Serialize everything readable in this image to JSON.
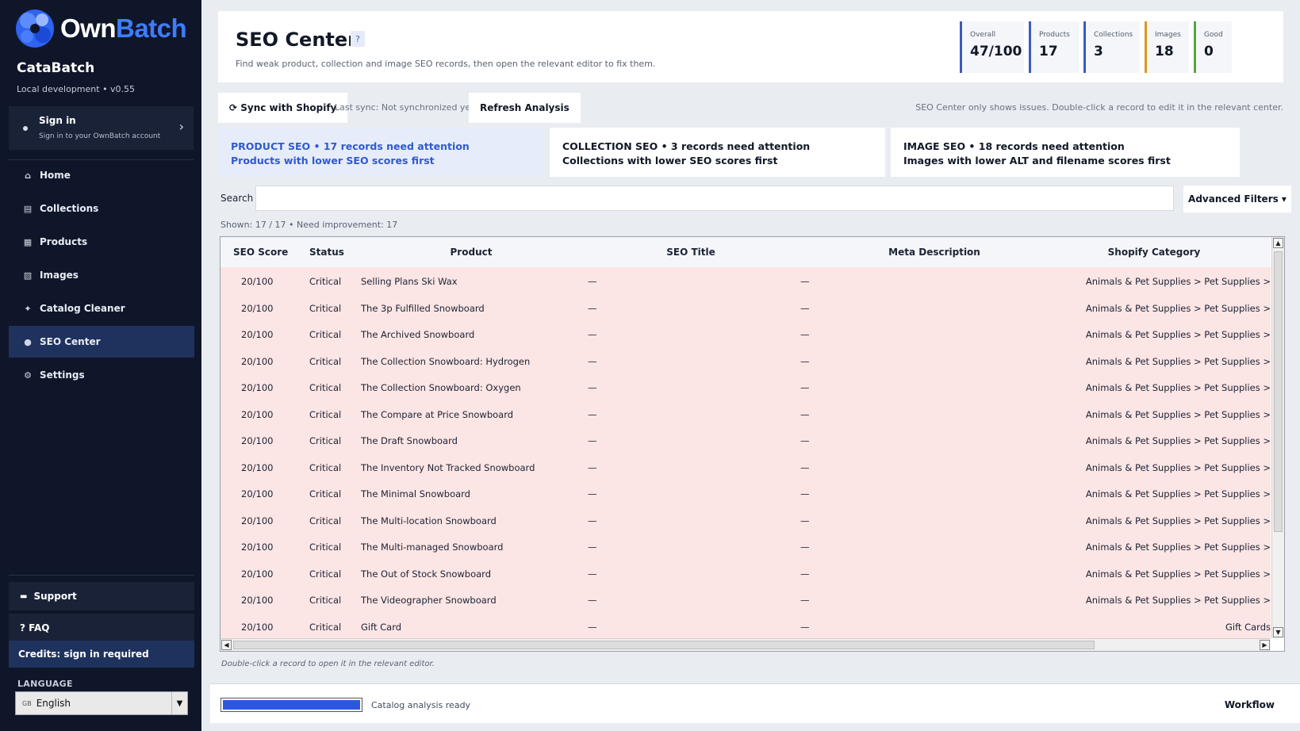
{
  "sidebar": {
    "brand_own": "Own",
    "brand_batch": "Batch",
    "app_name": "CataBatch",
    "app_version": "Local development • v0.55",
    "signin_title": "Sign in",
    "signin_sub": "Sign in to your OwnBatch account",
    "nav": [
      {
        "label": "Home",
        "icon": "home-icon",
        "glyph": "⌂"
      },
      {
        "label": "Collections",
        "icon": "collections-icon",
        "glyph": "▤"
      },
      {
        "label": "Products",
        "icon": "products-icon",
        "glyph": "▦"
      },
      {
        "label": "Images",
        "icon": "images-icon",
        "glyph": "▧"
      },
      {
        "label": "Catalog Cleaner",
        "icon": "sparkle-icon",
        "glyph": "✦"
      },
      {
        "label": "SEO Center",
        "icon": "seo-icon",
        "glyph": "●"
      },
      {
        "label": "Settings",
        "icon": "gear-icon",
        "glyph": "⚙"
      }
    ],
    "active_nav": "SEO Center",
    "support_label": "Support",
    "faq_label": "? FAQ",
    "credits_label": "Credits: sign in required",
    "language_label": "LANGUAGE",
    "language_flag": "GB",
    "language_value": "English"
  },
  "header": {
    "title": "SEO Center",
    "help": "?",
    "subtitle": "Find weak product, collection and image SEO records, then open the relevant editor to fix them.",
    "stats": [
      {
        "label": "Overall",
        "value": "47/100",
        "color": "#3a5bbf"
      },
      {
        "label": "Products",
        "value": "17",
        "color": "#3a5bbf"
      },
      {
        "label": "Collections",
        "value": "3",
        "color": "#3a5bbf"
      },
      {
        "label": "Images",
        "value": "18",
        "color": "#d79a1c"
      },
      {
        "label": "Good",
        "value": "0",
        "color": "#5da33a"
      }
    ]
  },
  "toolbar": {
    "sync_label": "⟳ Sync with Shopify",
    "last_sync": "Last sync: Not synchronized yet",
    "refresh_label": "Refresh Analysis",
    "hint": "SEO Center only shows issues. Double-click a record to edit it in the relevant center."
  },
  "cards": [
    {
      "line1": "PRODUCT SEO  •  17 records need attention",
      "line2": "Products with lower SEO scores first"
    },
    {
      "line1": "COLLECTION SEO  •  3 records need attention",
      "line2": "Collections with lower SEO scores first"
    },
    {
      "line1": "IMAGE SEO  •  18 records need attention",
      "line2": "Images with lower ALT and filename scores first"
    }
  ],
  "search": {
    "label": "Search",
    "value": "",
    "placeholder": ""
  },
  "advanced_filters": "Advanced Filters ▾",
  "shown_text": "Shown: 17 / 17 • Need improvement: 17",
  "table": {
    "columns": [
      "SEO Score",
      "Status",
      "Product",
      "SEO Title",
      "Meta Description",
      "Shopify Category"
    ],
    "rows": [
      [
        "20/100",
        "Critical",
        "Selling Plans Ski Wax",
        "—",
        "—",
        "Animals & Pet Supplies > Pet Supplies >"
      ],
      [
        "20/100",
        "Critical",
        "The 3p Fulfilled Snowboard",
        "—",
        "—",
        "Animals & Pet Supplies > Pet Supplies >"
      ],
      [
        "20/100",
        "Critical",
        "The Archived Snowboard",
        "—",
        "—",
        "Animals & Pet Supplies > Pet Supplies >"
      ],
      [
        "20/100",
        "Critical",
        "The Collection Snowboard: Hydrogen",
        "—",
        "—",
        "Animals & Pet Supplies > Pet Supplies >"
      ],
      [
        "20/100",
        "Critical",
        "The Collection Snowboard: Oxygen",
        "—",
        "—",
        "Animals & Pet Supplies > Pet Supplies >"
      ],
      [
        "20/100",
        "Critical",
        "The Compare at Price Snowboard",
        "—",
        "—",
        "Animals & Pet Supplies > Pet Supplies >"
      ],
      [
        "20/100",
        "Critical",
        "The Draft Snowboard",
        "—",
        "—",
        "Animals & Pet Supplies > Pet Supplies >"
      ],
      [
        "20/100",
        "Critical",
        "The Inventory Not Tracked Snowboard",
        "—",
        "—",
        "Animals & Pet Supplies > Pet Supplies >"
      ],
      [
        "20/100",
        "Critical",
        "The Minimal Snowboard",
        "—",
        "—",
        "Animals & Pet Supplies > Pet Supplies >"
      ],
      [
        "20/100",
        "Critical",
        "The Multi-location Snowboard",
        "—",
        "—",
        "Animals & Pet Supplies > Pet Supplies >"
      ],
      [
        "20/100",
        "Critical",
        "The Multi-managed Snowboard",
        "—",
        "—",
        "Animals & Pet Supplies > Pet Supplies >"
      ],
      [
        "20/100",
        "Critical",
        "The Out of Stock Snowboard",
        "—",
        "—",
        "Animals & Pet Supplies > Pet Supplies >"
      ],
      [
        "20/100",
        "Critical",
        "The Videographer Snowboard",
        "—",
        "—",
        "Animals & Pet Supplies > Pet Supplies >"
      ],
      [
        "20/100",
        "Critical",
        "Gift Card",
        "—",
        "—",
        "Gift Cards"
      ]
    ]
  },
  "table_hint": "Double-click a record to open it in the relevant editor.",
  "footer": {
    "progress": 1.0,
    "status": "Catalog analysis ready",
    "workflow": "Workflow"
  }
}
